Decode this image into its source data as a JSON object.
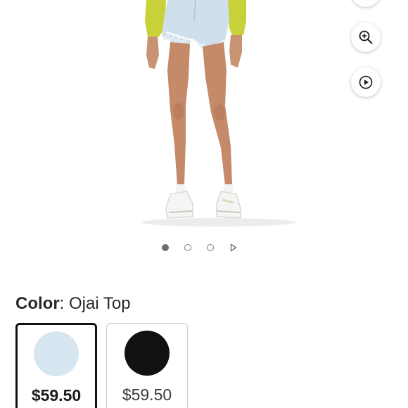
{
  "colors": {
    "accent_dark": "#111111",
    "dot_active": "#6f6f6f",
    "swatch_light_denim": "#d6e6f0",
    "swatch_black": "#111111"
  },
  "product_image": {
    "icon": "model-wearing-denim-shorts"
  },
  "tools": {
    "top_icon": "share-icon",
    "zoom_icon": "zoom-in-icon",
    "video_icon": "play-circle-icon"
  },
  "carousel": {
    "slide_count": 3,
    "active_index": 0,
    "has_video": true
  },
  "color_selector": {
    "label": "Color",
    "separator": ":",
    "selected_name": "Ojai Top",
    "swatches": [
      {
        "color": "#d6e6f0",
        "price": "$59.50",
        "selected": true
      },
      {
        "color": "#111111",
        "price": "$59.50",
        "selected": false
      }
    ]
  }
}
